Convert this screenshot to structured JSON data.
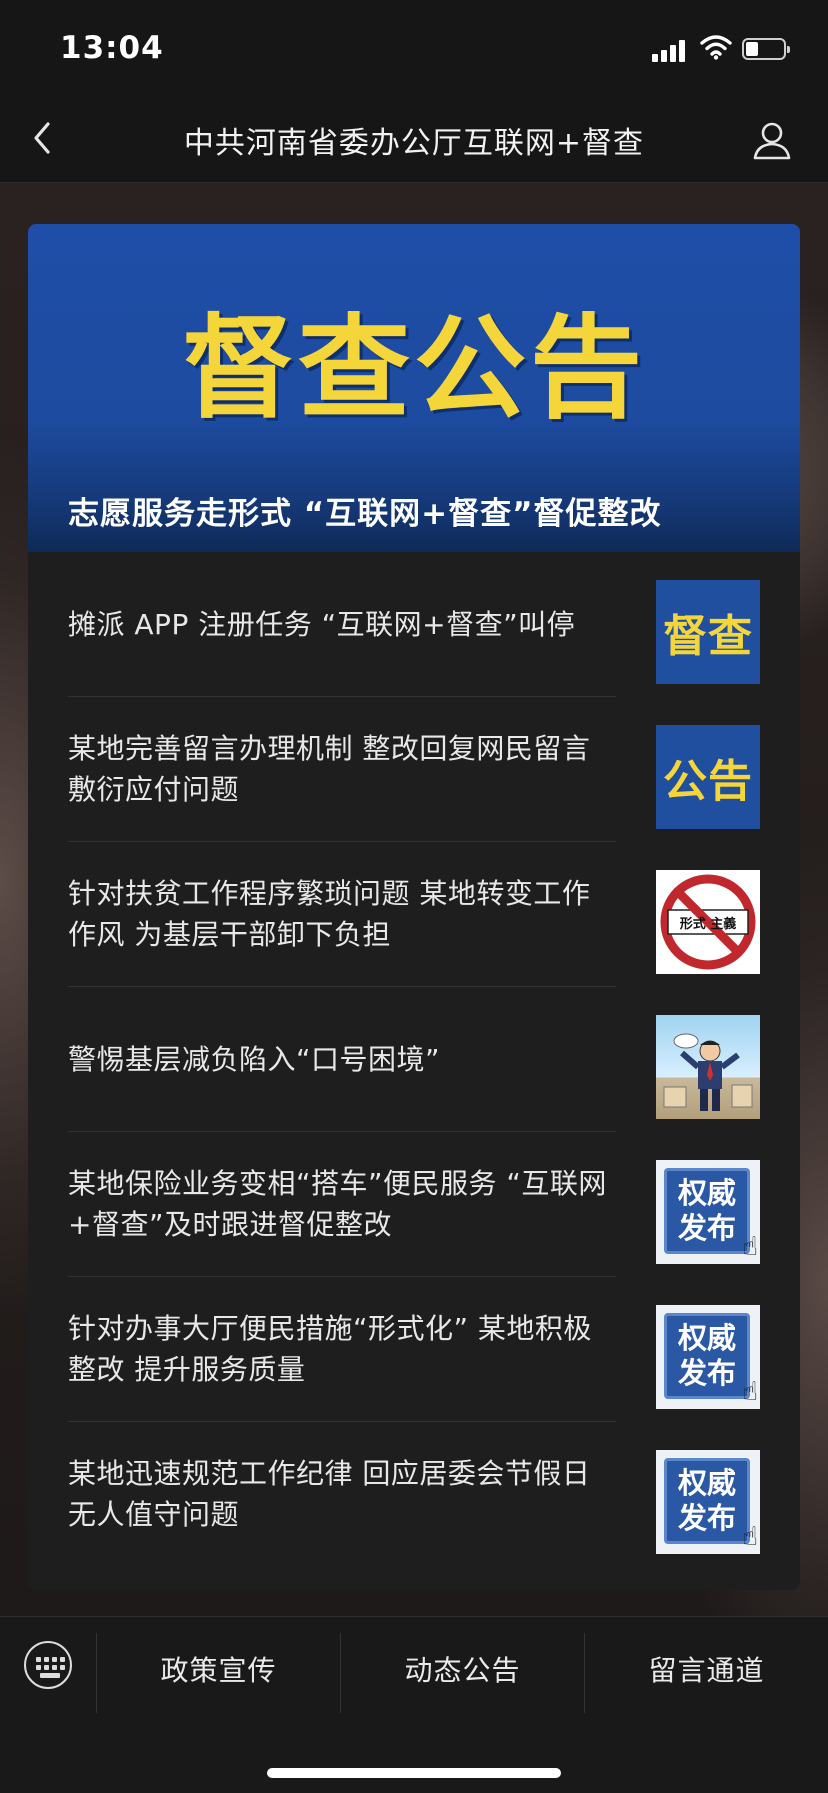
{
  "status_bar": {
    "time": "13:04"
  },
  "header": {
    "title": "中共河南省委办公厅互联网+督查"
  },
  "banner": {
    "big_text": "督查公告",
    "caption": "志愿服务走形式 “互联网+督查”督促整改"
  },
  "articles": [
    {
      "title": "摊派 APP 注册任务 “互联网+督查”叫停",
      "thumb": "dc",
      "thumb_text": "督查"
    },
    {
      "title": "某地完善留言办理机制  整改回复网民留言敷衍应付问题",
      "thumb": "gg",
      "thumb_text": "公告"
    },
    {
      "title": "针对扶贫工作程序繁琐问题  某地转变工作作风  为基层干部卸下负担",
      "thumb": "formalism",
      "thumb_text": "形式 主義"
    },
    {
      "title": "警惕基层减负陷入“口号困境”",
      "thumb": "cartoon",
      "thumb_text": ""
    },
    {
      "title": "某地保险业务变相“搭车”便民服务 “互联网+督查”及时跟进督促整改",
      "thumb": "auth",
      "thumb_text": "权威发布"
    },
    {
      "title": "针对办事大厅便民措施“形式化” 某地积极整改 提升服务质量",
      "thumb": "auth",
      "thumb_text": "权威发布"
    },
    {
      "title": "某地迅速规范工作纪律  回应居委会节假日无人值守问题",
      "thumb": "auth",
      "thumb_text": "权威发布"
    }
  ],
  "tab_bar": {
    "tabs": [
      "政策宣传",
      "动态公告",
      "留言通道"
    ]
  },
  "icons": {
    "back": "chevron-left-icon",
    "profile": "person-icon",
    "keyboard": "keyboard-icon"
  },
  "colors": {
    "banner_blue": "#1e4ea8",
    "banner_yellow": "#f5d63a"
  }
}
